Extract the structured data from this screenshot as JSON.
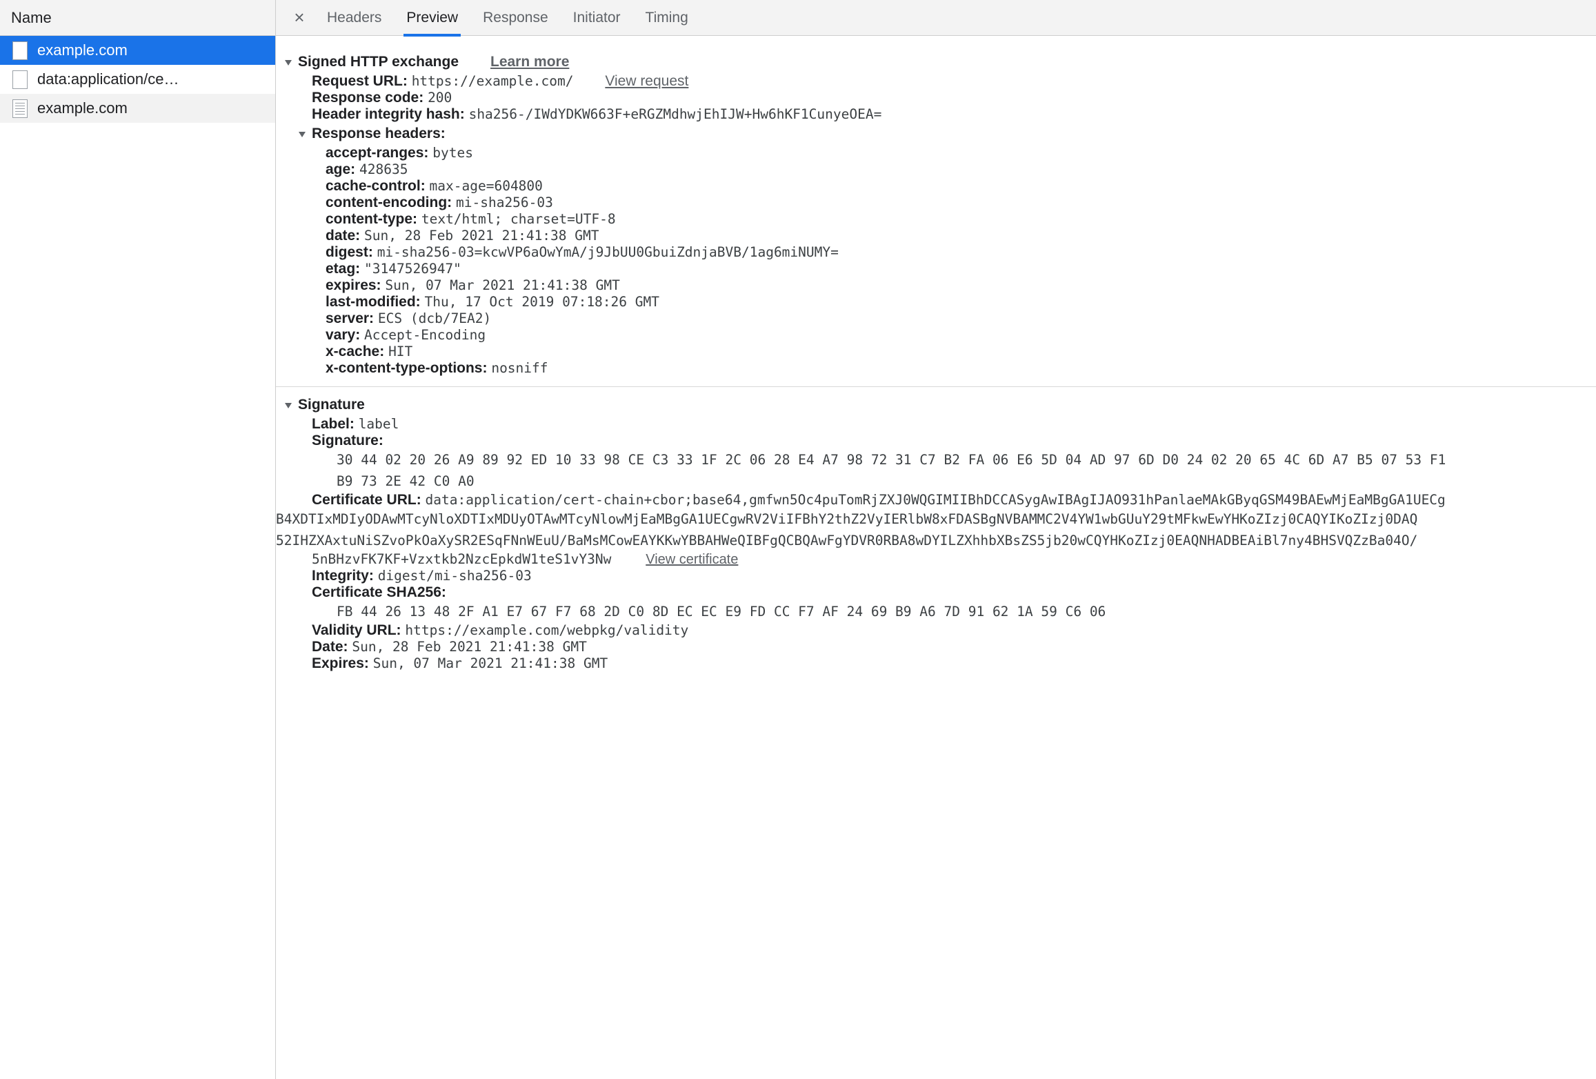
{
  "sidebar": {
    "column_header": "Name",
    "rows": [
      {
        "label": "example.com",
        "icon": "blank-file-icon",
        "selected": true,
        "zebra": false
      },
      {
        "label": "data:application/ce…",
        "icon": "blank-file-icon",
        "selected": false,
        "zebra": false
      },
      {
        "label": "example.com",
        "icon": "document-file-icon",
        "selected": false,
        "zebra": true
      }
    ]
  },
  "tabbar": {
    "close_label": "×",
    "tabs": [
      {
        "label": "Headers",
        "active": false
      },
      {
        "label": "Preview",
        "active": true
      },
      {
        "label": "Response",
        "active": false
      },
      {
        "label": "Initiator",
        "active": false
      },
      {
        "label": "Timing",
        "active": false
      }
    ],
    "accent_color": "#1a73e8"
  },
  "sxg": {
    "section_title": "Signed HTTP exchange",
    "learn_more": "Learn more",
    "request_url_key": "Request URL:",
    "request_url_value": "https://example.com/",
    "view_request": "View request",
    "response_code_key": "Response code:",
    "response_code_value": "200",
    "header_integrity_key": "Header integrity hash:",
    "header_integrity_value": "sha256-/IWdYDKW663F+eRGZMdhwjEhIJW+Hw6hKF1CunyeOEA=",
    "response_headers_title": "Response headers:",
    "response_headers": [
      {
        "key": "accept-ranges:",
        "value": "bytes"
      },
      {
        "key": "age:",
        "value": "428635"
      },
      {
        "key": "cache-control:",
        "value": "max-age=604800"
      },
      {
        "key": "content-encoding:",
        "value": "mi-sha256-03"
      },
      {
        "key": "content-type:",
        "value": "text/html; charset=UTF-8"
      },
      {
        "key": "date:",
        "value": "Sun, 28 Feb 2021 21:41:38 GMT"
      },
      {
        "key": "digest:",
        "value": "mi-sha256-03=kcwVP6aOwYmA/j9JbUU0GbuiZdnjaBVB/1ag6miNUMY="
      },
      {
        "key": "etag:",
        "value": "\"3147526947\""
      },
      {
        "key": "expires:",
        "value": "Sun, 07 Mar 2021 21:41:38 GMT"
      },
      {
        "key": "last-modified:",
        "value": "Thu, 17 Oct 2019 07:18:26 GMT"
      },
      {
        "key": "server:",
        "value": "ECS (dcb/7EA2)"
      },
      {
        "key": "vary:",
        "value": "Accept-Encoding"
      },
      {
        "key": "x-cache:",
        "value": "HIT"
      },
      {
        "key": "x-content-type-options:",
        "value": "nosniff"
      }
    ]
  },
  "signature": {
    "section_title": "Signature",
    "label_key": "Label:",
    "label_value": "label",
    "signature_key": "Signature:",
    "signature_hex_lines": [
      "30 44 02 20 26 A9 89 92 ED 10 33 98 CE C3 33 1F 2C 06 28 E4 A7 98 72 31 C7 B2 FA 06 E6 5D 04 AD 97 6D D0 24 02 20 65 4C 6D A7 B5 07 53 F1",
      "B9 73 2E 42 C0 A0"
    ],
    "certificate_url_key": "Certificate URL:",
    "certificate_url_lines": [
      "data:application/cert-chain+cbor;base64,gmfwn5Oc4puTomRjZXJ0WQGIMIIBhDCCASygAwIBAgIJAO931hPanlaeMAkGByqGSM49BAEwMjEaMBgGA1UECg",
      "B4XDTIxMDIyODAwMTcyNloXDTIxMDUyOTAwMTcyNlowMjEaMBgGA1UECgwRV2ViIFBhY2thZ2VyIERlbW8xFDASBgNVBAMMC2V4YW1wbGUuY29tMFkwEwYHKoZIzj0CAQYIKoZIzj0DAQ",
      "52IHZXAxtuNiSZvoPkOaXySR2ESqFNnWEuU/BaMsMCowEAYKKwYBBAHWeQIBFgQCBQAwFgYDVR0RBA8wDYILZXhhbXBsZS5jb20wCQYHKoZIzj0EAQNHADBEAiBl7ny4BHSVQZzBa04O/",
      "5nBHzvFK7KF+Vzxtkb2NzcEpkdW1teS1vY3Nw"
    ],
    "view_certificate": "View certificate",
    "integrity_key": "Integrity:",
    "integrity_value": "digest/mi-sha256-03",
    "cert_sha256_key": "Certificate SHA256:",
    "cert_sha256_value": "FB 44 26 13 48 2F A1 E7 67 F7 68 2D C0 8D EC EC E9 FD CC F7 AF 24 69 B9 A6 7D 91 62 1A 59 C6 06",
    "validity_url_key": "Validity URL:",
    "validity_url_value": "https://example.com/webpkg/validity",
    "date_key": "Date:",
    "date_value": "Sun, 28 Feb 2021 21:41:38 GMT",
    "expires_key": "Expires:",
    "expires_value": "Sun, 07 Mar 2021 21:41:38 GMT"
  }
}
